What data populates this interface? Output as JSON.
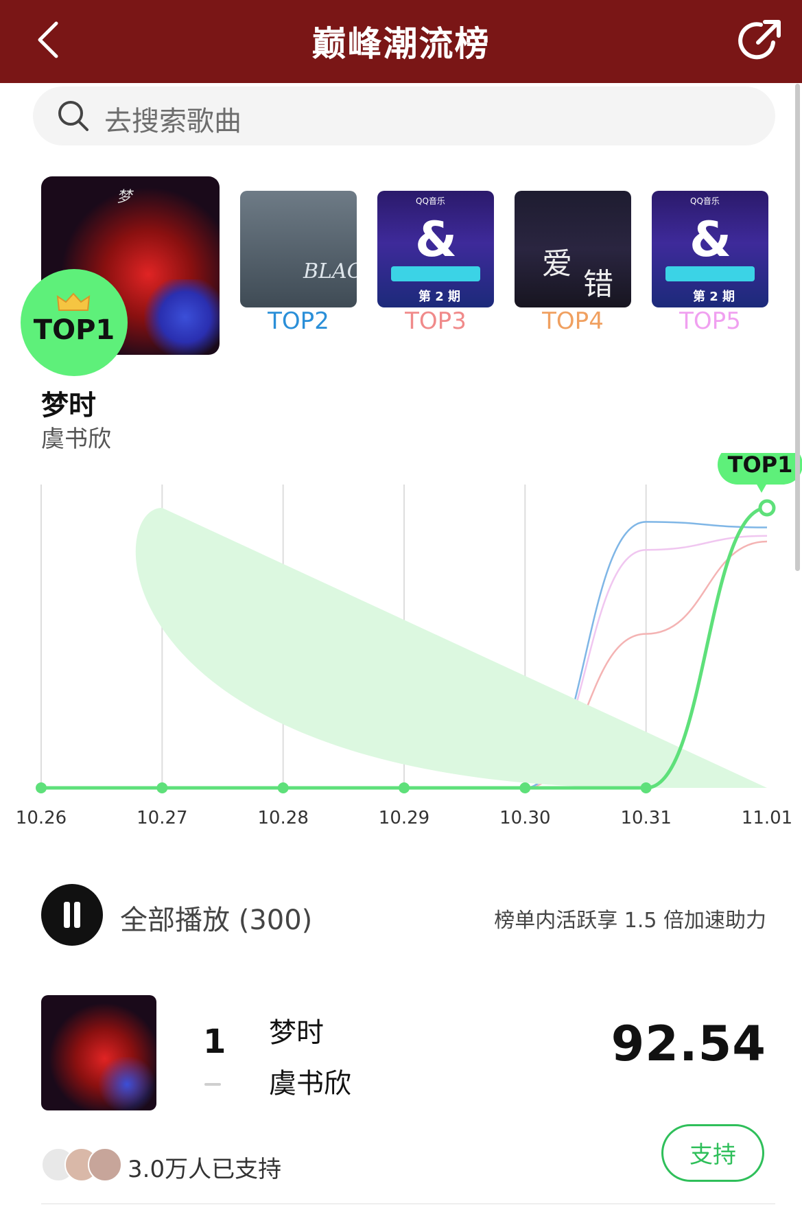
{
  "header": {
    "title": "巅峰潮流榜"
  },
  "search": {
    "placeholder": "去搜索歌曲"
  },
  "top_covers": [
    {
      "rank_label": "TOP1",
      "color": "#111111"
    },
    {
      "rank_label": "TOP2",
      "color": "#2a8fd8"
    },
    {
      "rank_label": "TOP3",
      "color": "#f08a8a"
    },
    {
      "rank_label": "TOP4",
      "color": "#f0a060"
    },
    {
      "rank_label": "TOP5",
      "color": "#f0a0f0"
    }
  ],
  "featured": {
    "badge": "TOP1",
    "title": "梦时",
    "artist": "虞书欣"
  },
  "chart_data": {
    "type": "line",
    "x": [
      "10.26",
      "10.27",
      "10.28",
      "10.29",
      "10.30",
      "10.31",
      "11.01"
    ],
    "series": [
      {
        "values": [
          0,
          0,
          0,
          0,
          0,
          0,
          1
        ],
        "color": "#5ee07a"
      },
      {
        "values": [
          0,
          0,
          0,
          0,
          0,
          0.95,
          0.93
        ],
        "color": "#7fb6e6"
      },
      {
        "values": [
          0,
          0,
          0,
          0,
          0,
          0.85,
          0.9
        ],
        "color": "#f0c6f0"
      },
      {
        "values": [
          0,
          0,
          0,
          0,
          0,
          0.55,
          0.88
        ],
        "color": "#f4b3b3"
      }
    ],
    "marker_label": "TOP1",
    "grid": true
  },
  "playbar": {
    "play_all": "全部播放 (300)",
    "boost": "榜单内活跃享 1.5 倍加速助力"
  },
  "list": [
    {
      "rank": "1",
      "title": "梦时",
      "artist": "虞书欣",
      "score": "92.54",
      "supporters": "3.0万人已支持",
      "support_label": "支持"
    }
  ],
  "colors": {
    "header_bg": "#7a1616",
    "accent_green": "#5ef07a",
    "support_green": "#2fbf5a"
  }
}
